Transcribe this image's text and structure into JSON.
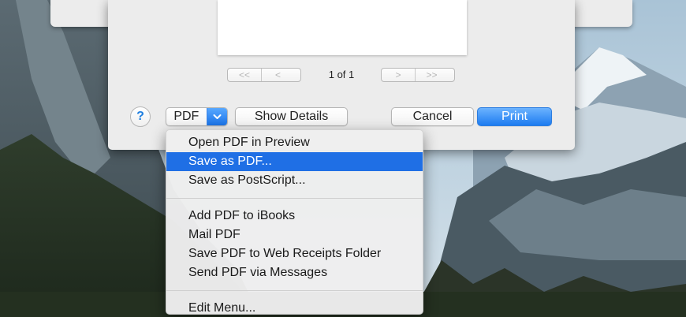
{
  "dialog": {
    "page_counter": "1 of 1",
    "nav_back": [
      "<<",
      "<"
    ],
    "nav_forward": [
      ">",
      ">>"
    ],
    "help_label": "?",
    "pdf_label": "PDF",
    "show_details_label": "Show Details",
    "cancel_label": "Cancel",
    "print_label": "Print"
  },
  "menu": {
    "group1": [
      "Open PDF in Preview",
      "Save as PDF...",
      "Save as PostScript..."
    ],
    "group2": [
      "Add PDF to iBooks",
      "Mail PDF",
      "Save PDF to Web Receipts Folder",
      "Send PDF via Messages"
    ],
    "group3": [
      "Edit Menu..."
    ],
    "selected": "Save as PDF..."
  },
  "colors": {
    "accent": "#1f6fe5",
    "menu_bg": "#eeeeee",
    "sheet_bg": "#ececec"
  },
  "icons": {
    "pdf_dropdown": "chevron-down-icon",
    "help": "question-icon"
  }
}
